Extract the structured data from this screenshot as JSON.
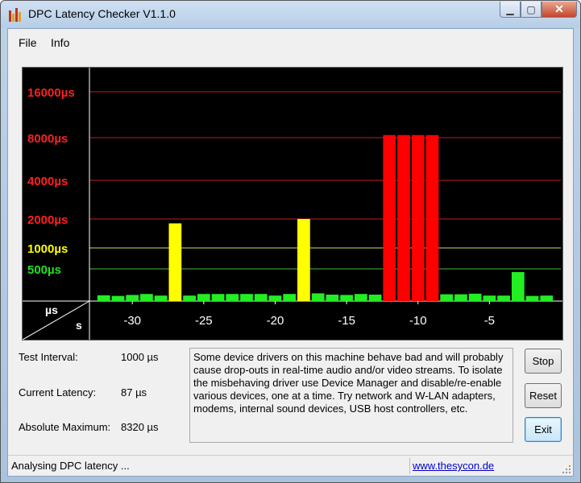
{
  "window": {
    "title": "DPC Latency Checker V1.1.0",
    "minimize": "▁",
    "maximize": "▢",
    "close": "✕"
  },
  "menu": {
    "items": [
      {
        "label": "File",
        "accel": "F"
      },
      {
        "label": "Info",
        "accel": "I"
      }
    ]
  },
  "chart_data": {
    "type": "bar",
    "ylabel": "µs",
    "xlabel": "s",
    "y_levels": [
      {
        "label": "16000µs",
        "value": 16000,
        "color": "#ff2020"
      },
      {
        "label": "8000µs",
        "value": 8000,
        "color": "#ff2020"
      },
      {
        "label": "4000µs",
        "value": 4000,
        "color": "#ff2020"
      },
      {
        "label": "2000µs",
        "value": 2000,
        "color": "#ff2020"
      },
      {
        "label": "1000µs",
        "value": 1000,
        "color": "#ffff00"
      },
      {
        "label": "500µs",
        "value": 500,
        "color": "#20e020"
      }
    ],
    "x_ticks": [
      -30,
      -25,
      -20,
      -15,
      -10,
      -5
    ],
    "x_tick_labels": [
      "-30",
      "-25",
      "-20",
      "-15",
      "-10",
      "-5"
    ],
    "x_range": [
      -33,
      0
    ],
    "x": [
      -32,
      -31,
      -30,
      -29,
      -28,
      -27,
      -26,
      -25,
      -24,
      -23,
      -22,
      -21,
      -20,
      -19,
      -18,
      -17,
      -16,
      -15,
      -14,
      -13,
      -12,
      -11,
      -10,
      -9,
      -8,
      -7,
      -6,
      -5,
      -4,
      -3,
      -2,
      -1
    ],
    "values": [
      90,
      80,
      95,
      110,
      85,
      1800,
      85,
      110,
      110,
      110,
      110,
      110,
      85,
      110,
      2000,
      120,
      100,
      95,
      110,
      100,
      8320,
      8320,
      8320,
      8320,
      105,
      105,
      115,
      85,
      85,
      450,
      80,
      85
    ],
    "bar_colors": {
      "low": "#22ee22",
      "mid": "#ffff00",
      "high": "#ff0000"
    },
    "grid": true
  },
  "stats": {
    "test_interval_label": "Test Interval:",
    "test_interval_value": "1000 µs",
    "current_latency_label": "Current Latency:",
    "current_latency_value": "87 µs",
    "absolute_max_label": "Absolute Maximum:",
    "absolute_max_value": "8320 µs"
  },
  "message": "Some device drivers on this machine behave bad and will probably cause drop-outs in real-time audio and/or video streams. To isolate the misbehaving driver use Device Manager and disable/re-enable various devices, one at a time. Try network and W-LAN adapters, modems, internal sound devices, USB host controllers, etc.",
  "buttons": {
    "stop": "Stop",
    "reset": "Reset",
    "exit": "Exit"
  },
  "status": {
    "text": "Analysing DPC latency ...",
    "link": "www.thesycon.de"
  }
}
